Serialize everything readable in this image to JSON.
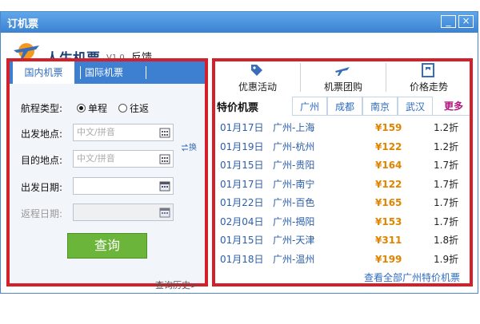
{
  "window": {
    "title": "订机票",
    "minimize_label": "_",
    "close_label": "×"
  },
  "header": {
    "brand": "人生机票",
    "version": "V1.0",
    "feedback": "反馈"
  },
  "left_panel": {
    "tabs": [
      "国内机票",
      "国际机票"
    ],
    "trip_type_label": "航程类型:",
    "trip_options": [
      {
        "label": "单程",
        "selected": true
      },
      {
        "label": "往返",
        "selected": false
      }
    ],
    "from_label": "出发地点:",
    "from_placeholder": "中文/拼音",
    "to_label": "目的地点:",
    "to_placeholder": "中文/拼音",
    "swap_label": "换",
    "depart_label": "出发日期:",
    "return_label": "返程日期:",
    "search_button": "查询",
    "history_link": "查询历史>"
  },
  "right_panel": {
    "top_tabs": [
      "优惠活动",
      "机票团购",
      "价格走势"
    ],
    "section_title": "特价机票",
    "city_tabs": [
      "广州",
      "成都",
      "南京",
      "武汉"
    ],
    "more_label": "更多",
    "rows": [
      {
        "date": "01月17日",
        "route": "广州-上海",
        "price": "¥159",
        "discount": "1.2折"
      },
      {
        "date": "01月19日",
        "route": "广州-杭州",
        "price": "¥122",
        "discount": "1.2折"
      },
      {
        "date": "01月15日",
        "route": "广州-贵阳",
        "price": "¥164",
        "discount": "1.7折"
      },
      {
        "date": "01月17日",
        "route": "广州-南宁",
        "price": "¥122",
        "discount": "1.7折"
      },
      {
        "date": "01月22日",
        "route": "广州-百色",
        "price": "¥165",
        "discount": "1.7折"
      },
      {
        "date": "02月04日",
        "route": "广州-揭阳",
        "price": "¥153",
        "discount": "1.7折"
      },
      {
        "date": "01月15日",
        "route": "广州-天津",
        "price": "¥311",
        "discount": "1.8折"
      },
      {
        "date": "01月18日",
        "route": "广州-温州",
        "price": "¥199",
        "discount": "1.9折"
      }
    ],
    "view_all": "查看全部广州特价机票"
  },
  "colors": {
    "accent_blue": "#3d7fd1",
    "highlight_red": "#d4202a",
    "button_green": "#6bb53a",
    "price_orange": "#e08400"
  }
}
